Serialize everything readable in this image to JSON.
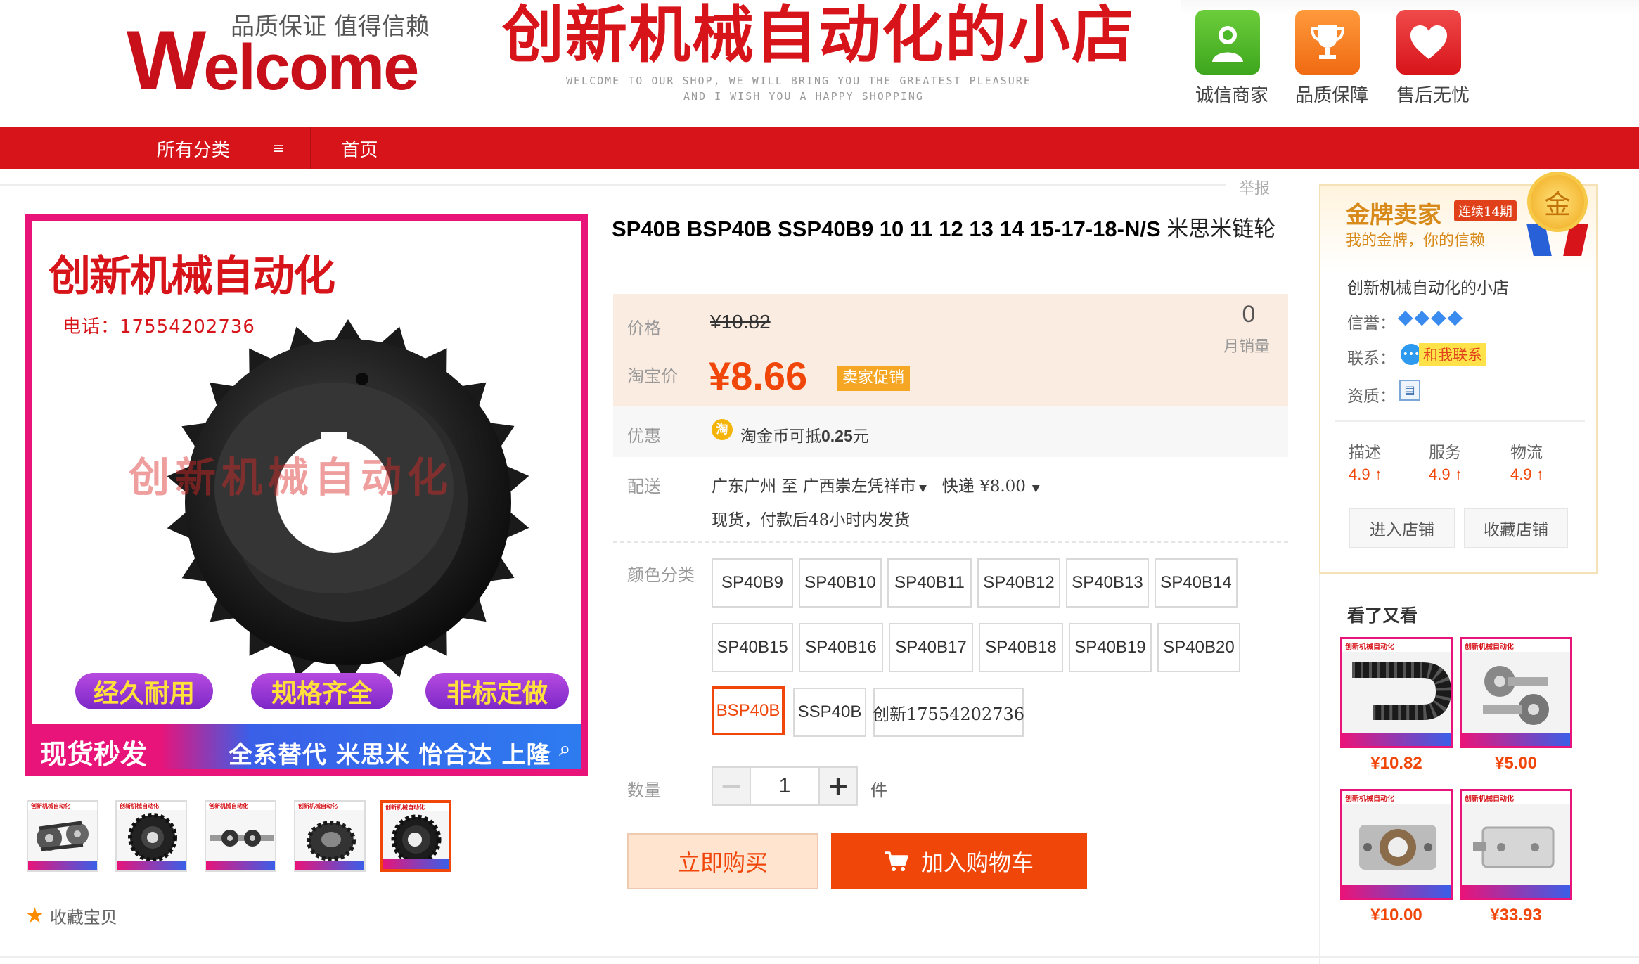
{
  "header": {
    "welcome_sub": "品质保证 值得信赖",
    "welcome_first": "W",
    "welcome_rest": "elcome",
    "shop_title": "创新机械自动化的小店",
    "shop_en_line1": "WELCOME TO OUR SHOP, WE WILL BRING YOU THE GREATEST PLEASURE",
    "shop_en_line2": "AND I WISH YOU A HAPPY SHOPPING",
    "badges": [
      {
        "label": "诚信商家",
        "icon": "user-badge-icon",
        "color": "#4cb82a"
      },
      {
        "label": "品质保障",
        "icon": "trophy-icon",
        "color": "#f07a1e"
      },
      {
        "label": "售后无忧",
        "icon": "heart-icon",
        "color": "#e02a2a"
      }
    ]
  },
  "nav": {
    "all_categories": "所有分类",
    "menu_glyph": "≡",
    "home": "首页"
  },
  "report": "举报",
  "gallery": {
    "promo_title": "创新机械自动化",
    "promo_phone": "电话：17554202736",
    "watermark": "创新机械自动化",
    "pills": [
      "经久耐用",
      "规格齐全",
      "非标定做"
    ],
    "bottom_left": "现货秒发",
    "bottom_right": "全系替代 米思米 怡合达 上隆",
    "thumb_banner": "创新机械自动化",
    "favorite": "收藏宝贝"
  },
  "product": {
    "title_en": "SP40B BSP40B SSP40B9 10 11 12 13 14 15-17-18-N/S ",
    "title_cn": "米思米链轮",
    "price_label": "价格",
    "original_price": "¥10.82",
    "taobao_price_label": "淘宝价",
    "promo_price": "¥8.66",
    "promo_tag": "卖家促销",
    "monthly_sales": "0",
    "monthly_sales_label": "月销量",
    "discount_label": "优惠",
    "coin_icon": "淘",
    "coin_text_pre": "淘金币可抵",
    "coin_value": "0.25",
    "coin_text_post": "元",
    "ship_label": "配送",
    "ship_from": "广东广州 至 ",
    "ship_to": "广西崇左凭祥市",
    "ship_method": "快递 ¥8.00",
    "ship_note": "现货，付款后48小时内发货",
    "color_label": "颜色分类",
    "skus_row1": [
      "SP40B9",
      "SP40B10",
      "SP40B11",
      "SP40B12",
      "SP40B13",
      "SP40B14"
    ],
    "skus_row2": [
      "SP40B15",
      "SP40B16",
      "SP40B17",
      "SP40B18",
      "SP40B19",
      "SP40B20"
    ],
    "skus_row3": [
      "BSP40B",
      "SSP40B",
      "创新17554202736"
    ],
    "selected_sku": "BSP40B",
    "qty_label": "数量",
    "qty_minus": "−",
    "qty_value": "1",
    "qty_plus": "+",
    "qty_unit": "件",
    "buy_now": "立即购买",
    "add_to_cart": "加入购物车"
  },
  "seller": {
    "gold_title": "金牌卖家",
    "gold_streak": "连续14期",
    "gold_slogan": "我的金牌，你的信赖",
    "medal_text": "金",
    "shop_name": "创新机械自动化的小店",
    "credit_label": "信誉：",
    "credit_diamonds": "◆◆◆◆",
    "contact_label": "联系：",
    "contact_text": "和我联系",
    "qualification_label": "资质：",
    "dsr": [
      {
        "label": "描述",
        "value": "4.9 ↑"
      },
      {
        "label": "服务",
        "value": "4.9 ↑"
      },
      {
        "label": "物流",
        "value": "4.9 ↑"
      }
    ],
    "enter_shop": "进入店铺",
    "favorite_shop": "收藏店铺"
  },
  "also_viewed": {
    "title": "看了又看",
    "banner": "创新机械自动化",
    "items": [
      {
        "price": "¥10.82"
      },
      {
        "price": "¥5.00"
      },
      {
        "price": "¥10.00"
      },
      {
        "price": "¥33.93"
      }
    ]
  },
  "colors": {
    "brand_red": "#d7141a",
    "accent_orange": "#f0460a",
    "gold": "#d7891a"
  }
}
